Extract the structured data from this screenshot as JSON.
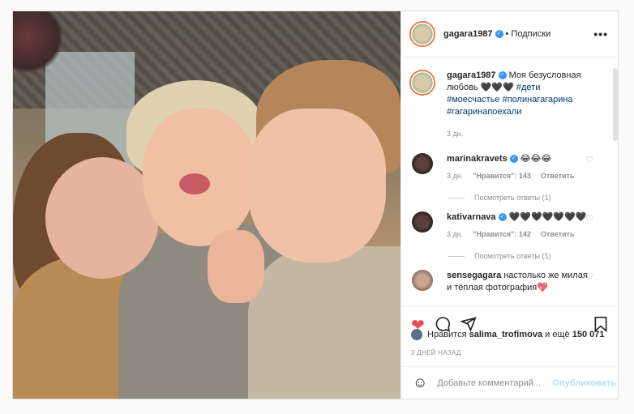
{
  "post": {
    "username": "gagara1987",
    "follow_label": "Подписки",
    "dot": "•",
    "more": "•••",
    "caption": {
      "username": "gagara1987",
      "text": "Моя безусловная любовь 🖤🖤🖤",
      "tags": [
        "#дети",
        "#моесчастье",
        "#полинагагарина",
        "#гагаринапоехали"
      ],
      "time": "3 дн."
    },
    "comments": [
      {
        "username": "marinakravets",
        "text": "😂😂😂",
        "time": "3 дн.",
        "likes": "\"Нравится\": 143",
        "reply": "Ответить",
        "view_replies": "Посмотреть ответы (1)"
      },
      {
        "username": "kativarnava",
        "text": "🖤🖤🖤🖤🖤🖤🖤",
        "time": "3 дн.",
        "likes": "\"Нравится\": 142",
        "reply": "Ответить",
        "view_replies": "Посмотреть ответы (1)"
      },
      {
        "username": "sensegagara",
        "text": "настолько же милая и тёплая фотография💖"
      }
    ],
    "icons": [
      "heart-filled",
      "comment",
      "share",
      "bookmark"
    ],
    "likes": {
      "prefix": "Нравится",
      "user": "salima_trofimova",
      "middle": "и ещё",
      "count": "150 071"
    },
    "date": "3 ДНЕЙ НАЗАД",
    "add_comment_placeholder": "Добавьте комментарий...",
    "publish": "Опубликовать"
  }
}
